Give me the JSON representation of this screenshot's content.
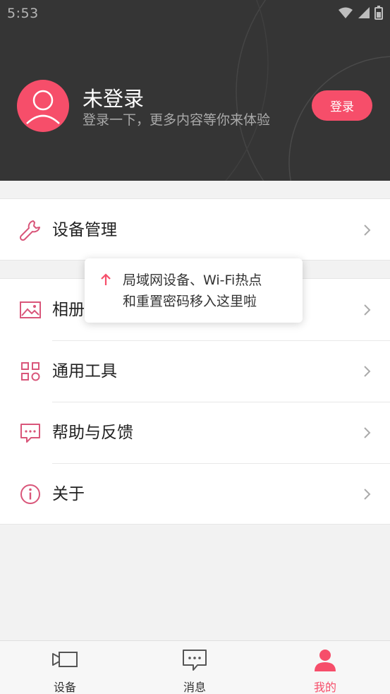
{
  "status_bar": {
    "time": "5:53"
  },
  "profile": {
    "name": "未登录",
    "subtitle": "登录一下，更多内容等你来体验",
    "login_label": "登录"
  },
  "menu": {
    "device_manage": {
      "label": "设备管理",
      "icon": "wrench-icon"
    },
    "items": [
      {
        "label": "相册",
        "icon": "image-icon"
      },
      {
        "label": "通用工具",
        "icon": "grid-icon"
      },
      {
        "label": "帮助与反馈",
        "icon": "chat-dots-icon"
      },
      {
        "label": "关于",
        "icon": "info-icon"
      }
    ]
  },
  "tooltip": {
    "line1": "局域网设备、Wi-Fi热点",
    "line2": "和重置密码移入这里啦"
  },
  "bottom_nav": {
    "tabs": [
      {
        "label": "设备",
        "icon": "camera-device-icon"
      },
      {
        "label": "消息",
        "icon": "message-icon"
      },
      {
        "label": "我的",
        "icon": "person-icon",
        "active": true
      }
    ]
  },
  "colors": {
    "accent": "#f64e6a",
    "header_bg": "#353535",
    "icon": "#d9567a"
  }
}
